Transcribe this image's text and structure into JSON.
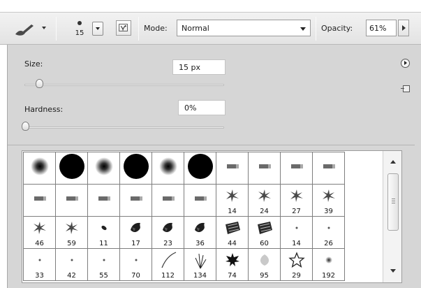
{
  "options_bar": {
    "tool_icon": "brush-tool-icon",
    "brush_size": "15",
    "airbrush_icon": "airbrush-toggle-icon",
    "mode_label": "Mode:",
    "mode_value": "Normal",
    "opacity_label": "Opacity:",
    "opacity_value": "61%"
  },
  "panel": {
    "size_label": "Size:",
    "size_value": "15 px",
    "size_slider_fraction": 0.07,
    "hardness_label": "Hardness:",
    "hardness_value": "0%",
    "hardness_slider_fraction": 0.0,
    "menu_icon": "panel-menu-icon",
    "new_preset_icon": "new-preset-icon"
  },
  "brushes": [
    {
      "kind": "soft-round",
      "label": ""
    },
    {
      "kind": "hard-round",
      "label": ""
    },
    {
      "kind": "soft-round",
      "label": ""
    },
    {
      "kind": "hard-round",
      "label": ""
    },
    {
      "kind": "soft-round",
      "label": ""
    },
    {
      "kind": "hard-round",
      "label": ""
    },
    {
      "kind": "calligraphic",
      "label": ""
    },
    {
      "kind": "calligraphic",
      "label": ""
    },
    {
      "kind": "calligraphic",
      "label": ""
    },
    {
      "kind": "calligraphic",
      "label": ""
    },
    {
      "kind": "calligraphic",
      "label": ""
    },
    {
      "kind": "calligraphic",
      "label": ""
    },
    {
      "kind": "calligraphic",
      "label": ""
    },
    {
      "kind": "calligraphic",
      "label": ""
    },
    {
      "kind": "calligraphic",
      "label": ""
    },
    {
      "kind": "calligraphic",
      "label": ""
    },
    {
      "kind": "scatter",
      "label": "14"
    },
    {
      "kind": "scatter",
      "label": "24"
    },
    {
      "kind": "scatter",
      "label": "27"
    },
    {
      "kind": "scatter",
      "label": "39"
    },
    {
      "kind": "scatter",
      "label": "46"
    },
    {
      "kind": "scatter",
      "label": "59"
    },
    {
      "kind": "dab",
      "label": "11"
    },
    {
      "kind": "leaf",
      "label": "17"
    },
    {
      "kind": "leaf",
      "label": "23"
    },
    {
      "kind": "leaf",
      "label": "36"
    },
    {
      "kind": "chalk",
      "label": "44"
    },
    {
      "kind": "chalk",
      "label": "60"
    },
    {
      "kind": "dot",
      "label": "14"
    },
    {
      "kind": "dot",
      "label": "26"
    },
    {
      "kind": "dot",
      "label": "33"
    },
    {
      "kind": "dot",
      "label": "42"
    },
    {
      "kind": "dot",
      "label": "55"
    },
    {
      "kind": "dot",
      "label": "70"
    },
    {
      "kind": "stroke",
      "label": "112"
    },
    {
      "kind": "grass",
      "label": "134"
    },
    {
      "kind": "maple",
      "label": "74"
    },
    {
      "kind": "petal",
      "label": "95"
    },
    {
      "kind": "star",
      "label": "29"
    },
    {
      "kind": "soft-dot",
      "label": "192"
    }
  ]
}
